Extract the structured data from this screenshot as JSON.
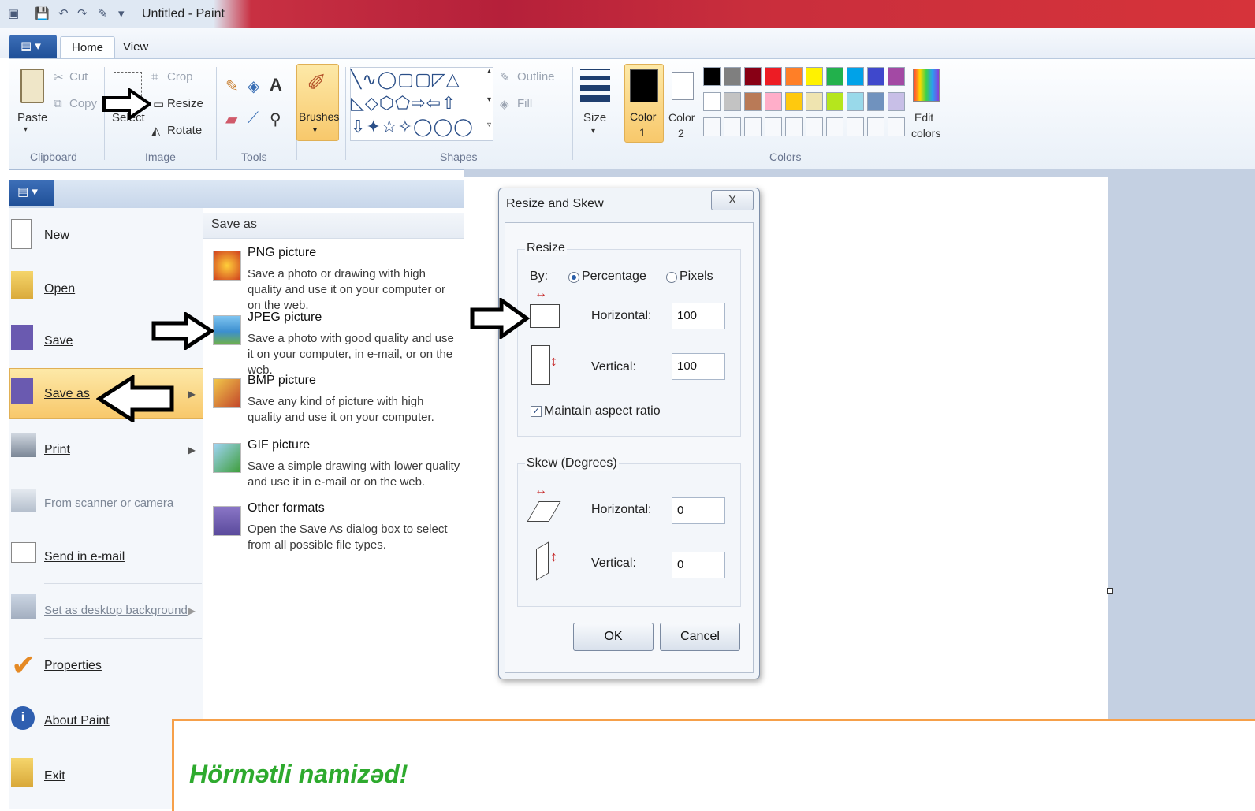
{
  "window": {
    "title": "Untitled - Paint"
  },
  "ribbon": {
    "tabs": [
      "Home",
      "View"
    ],
    "clipboard": {
      "paste": "Paste",
      "cut": "Cut",
      "copy": "Copy",
      "group": "Clipboard"
    },
    "image": {
      "select": "Select",
      "crop": "Crop",
      "resize": "Resize",
      "rotate": "Rotate",
      "group": "Image"
    },
    "tools": {
      "group": "Tools"
    },
    "brushes": "Brushes",
    "shapes": {
      "outline": "Outline",
      "fill": "Fill",
      "group": "Shapes"
    },
    "size": "Size",
    "color1": [
      "Color",
      "1"
    ],
    "color2": [
      "Color",
      "2"
    ],
    "colors_group": "Colors",
    "edit_colors": [
      "Edit",
      "colors"
    ],
    "palette_row1": [
      "#000000",
      "#7f7f7f",
      "#880015",
      "#ed1c24",
      "#ff7f27",
      "#fff200",
      "#22b14c",
      "#00a2e8",
      "#3f48cc",
      "#a349a4"
    ],
    "palette_row2": [
      "#ffffff",
      "#c3c3c3",
      "#b97a57",
      "#ffaec9",
      "#ffc90e",
      "#efe4b0",
      "#b5e61d",
      "#99d9ea",
      "#7092be",
      "#c8bfe7"
    ]
  },
  "file_menu": {
    "items": [
      {
        "label": "New",
        "icon": "new-file-icon"
      },
      {
        "label": "Open",
        "icon": "open-folder-icon"
      },
      {
        "label": "Save",
        "icon": "floppy-disk-icon"
      },
      {
        "label": "Save as",
        "icon": "save-as-icon"
      },
      {
        "label": "Print",
        "icon": "printer-icon"
      },
      {
        "label": "From scanner or camera",
        "icon": "scanner-icon"
      },
      {
        "label": "Send in e-mail",
        "icon": "email-icon"
      },
      {
        "label": "Set as desktop background",
        "icon": "desktop-icon"
      },
      {
        "label": "Properties",
        "icon": "checkmark-icon"
      },
      {
        "label": "About Paint",
        "icon": "info-icon"
      },
      {
        "label": "Exit",
        "icon": "exit-icon"
      }
    ]
  },
  "save_as_panel": {
    "title": "Save as",
    "options": [
      {
        "title": "PNG picture",
        "desc": "Save a photo or drawing with high quality and use it on your computer or on the web."
      },
      {
        "title": "JPEG picture",
        "desc": "Save a photo with good quality and use it on your computer, in e-mail, or on the web."
      },
      {
        "title": "BMP picture",
        "desc": "Save any kind of picture with high quality and use it on your computer."
      },
      {
        "title": "GIF picture",
        "desc": "Save a simple drawing with lower quality and use it in e-mail or on the web."
      },
      {
        "title": "Other formats",
        "desc": "Open the Save As dialog box to select from all possible file types."
      }
    ]
  },
  "dialog": {
    "title": "Resize and Skew",
    "close": "X",
    "resize_group": "Resize",
    "by": "By:",
    "percentage": "Percentage",
    "pixels": "Pixels",
    "horizontal": "Horizontal:",
    "vertical": "Vertical:",
    "resize_h": "100",
    "resize_v": "100",
    "maintain": "Maintain aspect ratio",
    "skew_group": "Skew (Degrees)",
    "skew_h": "0",
    "skew_v": "0",
    "ok": "OK",
    "cancel": "Cancel"
  },
  "notice": {
    "text": "Hörmətli namizəd!"
  }
}
